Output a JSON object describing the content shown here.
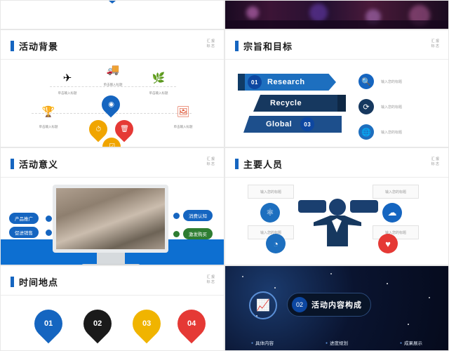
{
  "slides": [
    {
      "id": "photo-strip-left",
      "type": "photo",
      "caption": ""
    },
    {
      "id": "photo-strip-right",
      "type": "photo-stage",
      "caption": ""
    },
    {
      "id": "background",
      "title": "活动背景",
      "corner_note": "汇 报\n标 志",
      "icons": [
        {
          "glyph": "✈",
          "caption": "单击输入标题"
        },
        {
          "glyph": "🚚",
          "caption": "单击输入标题"
        },
        {
          "glyph": "🌿",
          "caption": "单击输入标题"
        },
        {
          "glyph": "🏆",
          "caption": "单击输入标题"
        },
        {
          "glyph": "🖼",
          "caption": "单击输入标题"
        }
      ],
      "pins": [
        {
          "glyph": "◉",
          "color": "#1565c0"
        },
        {
          "glyph": "⏱",
          "color": "#f0a500"
        },
        {
          "glyph": "🗑",
          "color": "#e53935"
        },
        {
          "glyph": "☑",
          "color": "#f0a500"
        }
      ]
    },
    {
      "id": "purpose",
      "title": "宗旨和目标",
      "corner_note": "汇 报\n标 志",
      "ribbons": [
        {
          "num": "01",
          "label": "Research",
          "color": "#1d6fbf"
        },
        {
          "num": "",
          "label": "Recycle",
          "color": "#16385f"
        },
        {
          "num": "03",
          "label": "Global",
          "color": "#1d4f8c"
        }
      ],
      "right_items": [
        {
          "icon": "🔍",
          "color": "#1565c0",
          "label": "输入您的标题"
        },
        {
          "icon": "⟳",
          "color": "#16385f",
          "label": "输入您的标题"
        },
        {
          "icon": "🌐",
          "color": "#1d6fbf",
          "label": "输入您的标题"
        }
      ]
    },
    {
      "id": "significance",
      "title": "活动意义",
      "corner_note": "汇 报\n标 志",
      "left_tags": [
        {
          "label": "产品推广",
          "color": "#1565c0"
        },
        {
          "label": "促进销售",
          "color": "#1565c0"
        }
      ],
      "right_tags": [
        {
          "label": "消费认知",
          "color": "#1565c0"
        },
        {
          "label": "激发购买",
          "color": "#2e7d32"
        }
      ]
    },
    {
      "id": "people",
      "title": "主要人员",
      "corner_note": "汇 报\n标 志",
      "bubbles": [
        {
          "label": "输入您的标题"
        },
        {
          "label": "输入您的标题"
        },
        {
          "label": "输入您的标题"
        },
        {
          "label": "输入您的标题"
        }
      ],
      "icons": [
        {
          "glyph": "⚛",
          "color": "#1d6fbf"
        },
        {
          "glyph": "☁",
          "color": "#1565c0"
        },
        {
          "glyph": "◔",
          "color": "#1d6fbf"
        },
        {
          "glyph": "♥",
          "color": "#e53935"
        }
      ]
    },
    {
      "id": "time-place",
      "title": "时间地点",
      "corner_note": "汇 报\n标 志",
      "drops": [
        {
          "num": "01",
          "color": "#1565c0"
        },
        {
          "num": "02",
          "color": "#1a1a1a"
        },
        {
          "num": "03",
          "color": "#f0b400"
        },
        {
          "num": "04",
          "color": "#e53935"
        }
      ]
    },
    {
      "id": "content-structure",
      "title": "活动内容构成",
      "number": "02",
      "icon": "📈",
      "bullets": [
        "具体内容",
        "进度规划",
        "成果展示"
      ]
    }
  ]
}
